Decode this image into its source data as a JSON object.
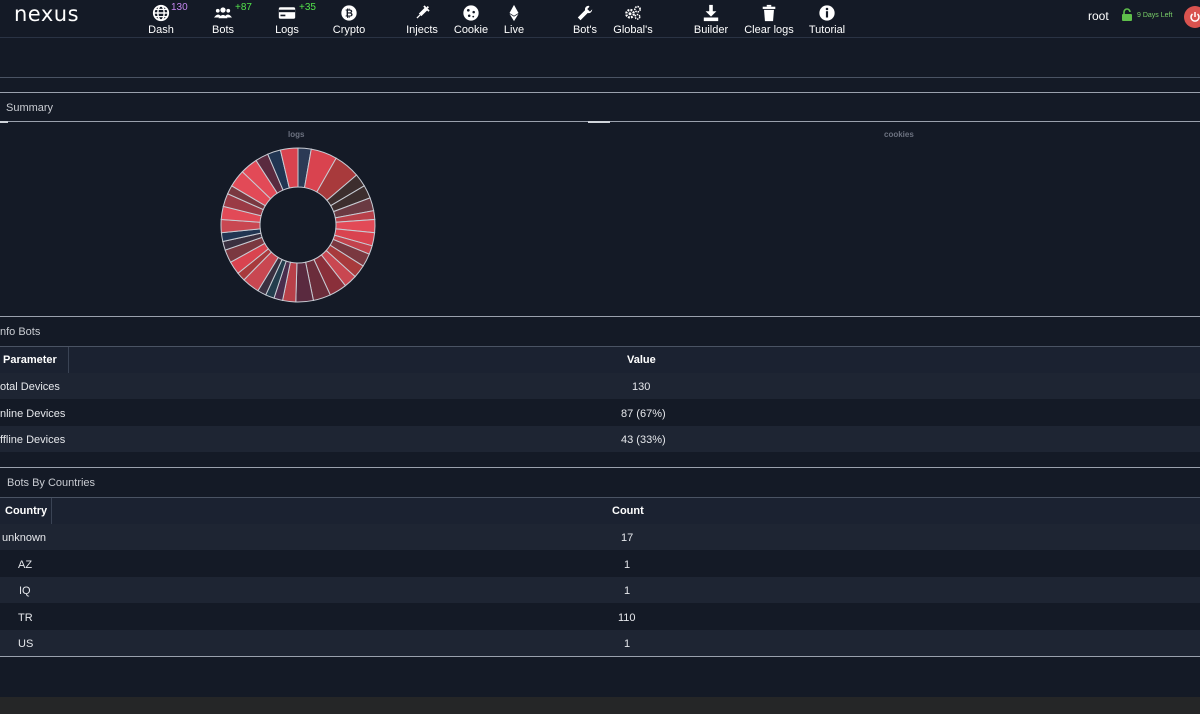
{
  "brand": "nexus",
  "nav": [
    {
      "label": "Dash",
      "badge": "130",
      "badge_color": "purple"
    },
    {
      "label": "Bots",
      "badge": "+87",
      "badge_color": "green"
    },
    {
      "label": "Logs",
      "badge": "+35",
      "badge_color": "green"
    },
    {
      "label": "Crypto"
    },
    {
      "label": "Injects"
    },
    {
      "label": "Cookie"
    },
    {
      "label": "Live"
    },
    {
      "label": "Bot's"
    },
    {
      "label": "Global's"
    },
    {
      "label": "Builder"
    },
    {
      "label": "Clear logs"
    },
    {
      "label": "Tutorial"
    }
  ],
  "user": {
    "name": "root",
    "days_left": "9 Days Left"
  },
  "summary": {
    "title": "Summary",
    "logs_label": "logs",
    "cookies_label": "cookies"
  },
  "info_bots": {
    "title": "nfo Bots",
    "headers": {
      "param": "Parameter",
      "value": "Value"
    },
    "rows": [
      {
        "param": "otal Devices",
        "value": "130"
      },
      {
        "param": "nline Devices",
        "value": "87 (67%)"
      },
      {
        "param": "ffline Devices",
        "value": "43 (33%)"
      }
    ]
  },
  "countries": {
    "title": "Bots By Countries",
    "headers": {
      "country": "Country",
      "count": "Count"
    },
    "rows": [
      {
        "country": "unknown",
        "count": "17"
      },
      {
        "country": "AZ",
        "count": "1"
      },
      {
        "country": "IQ",
        "count": "1"
      },
      {
        "country": "TR",
        "count": "110"
      },
      {
        "country": "US",
        "count": "1"
      }
    ]
  },
  "chart_data": {
    "type": "pie",
    "title": "logs",
    "segment_colors": [
      "#2b3a55",
      "#d9434f",
      "#a83a3c",
      "#3d2e2e",
      "#3d2e2e",
      "#6a3a42",
      "#b84049",
      "#e24a57",
      "#d9434f",
      "#c2424c",
      "#7a3840",
      "#a83a3c",
      "#c94751",
      "#8a2f3a",
      "#6b2d3b",
      "#5a2a3f",
      "#b84049",
      "#4a2d4d",
      "#233d4d",
      "#3a3040",
      "#c94751",
      "#a83a3c",
      "#d9434f",
      "#7a3840",
      "#3a3040",
      "#213552",
      "#c94751",
      "#e24a57",
      "#9a3a45",
      "#7a3840",
      "#e24a57",
      "#e24a57",
      "#5a2a3f",
      "#213552",
      "#d9434f"
    ],
    "values": [
      3,
      6,
      6,
      3,
      3,
      3,
      2,
      3,
      3,
      2,
      3,
      3,
      3,
      4,
      4,
      4,
      3,
      2,
      2,
      2,
      4,
      2,
      3,
      3,
      2,
      2,
      3,
      3,
      3,
      2,
      4,
      4,
      3,
      3,
      4
    ]
  }
}
